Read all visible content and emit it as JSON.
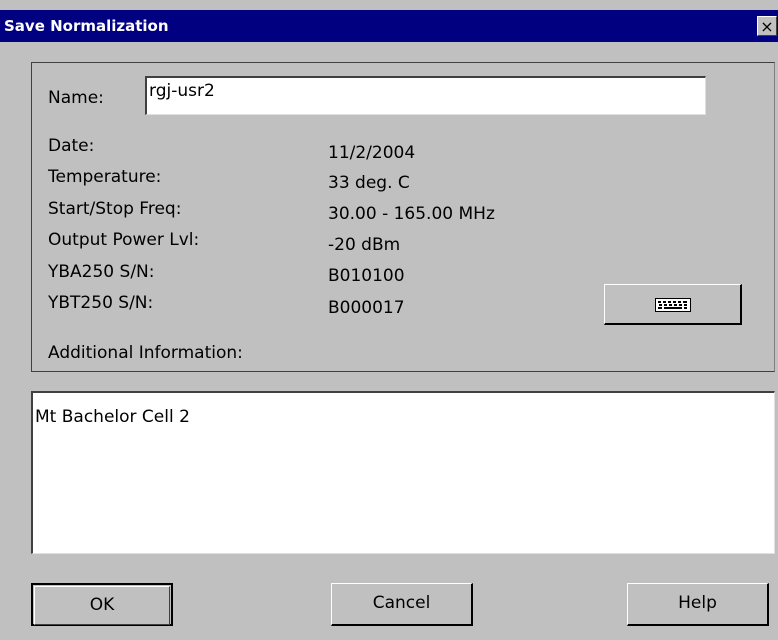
{
  "window": {
    "title": "Save Normalization",
    "close_glyph": "×"
  },
  "form": {
    "name_label": "Name:",
    "name_value": "rgj-usr2",
    "fields": [
      {
        "label": "Date:",
        "value": "11/2/2004"
      },
      {
        "label": "Temperature:",
        "value": "33 deg. C"
      },
      {
        "label": "Start/Stop Freq:",
        "value": "30.00 - 165.00 MHz"
      },
      {
        "label": "Output Power Lvl:",
        "value": "-20 dBm"
      },
      {
        "label": "YBA250 S/N:",
        "value": "B010100"
      },
      {
        "label": "YBT250 S/N:",
        "value": "B000017"
      }
    ],
    "additional_label": "Additional Information:",
    "additional_value": "Mt Bachelor Cell 2",
    "keyboard_icon": "keyboard-icon"
  },
  "buttons": {
    "ok": "OK",
    "cancel": "Cancel",
    "help": "Help"
  },
  "colors": {
    "titlebar": "#000080",
    "dialog_bg": "#c0c0c0",
    "input_bg": "#ffffff"
  }
}
